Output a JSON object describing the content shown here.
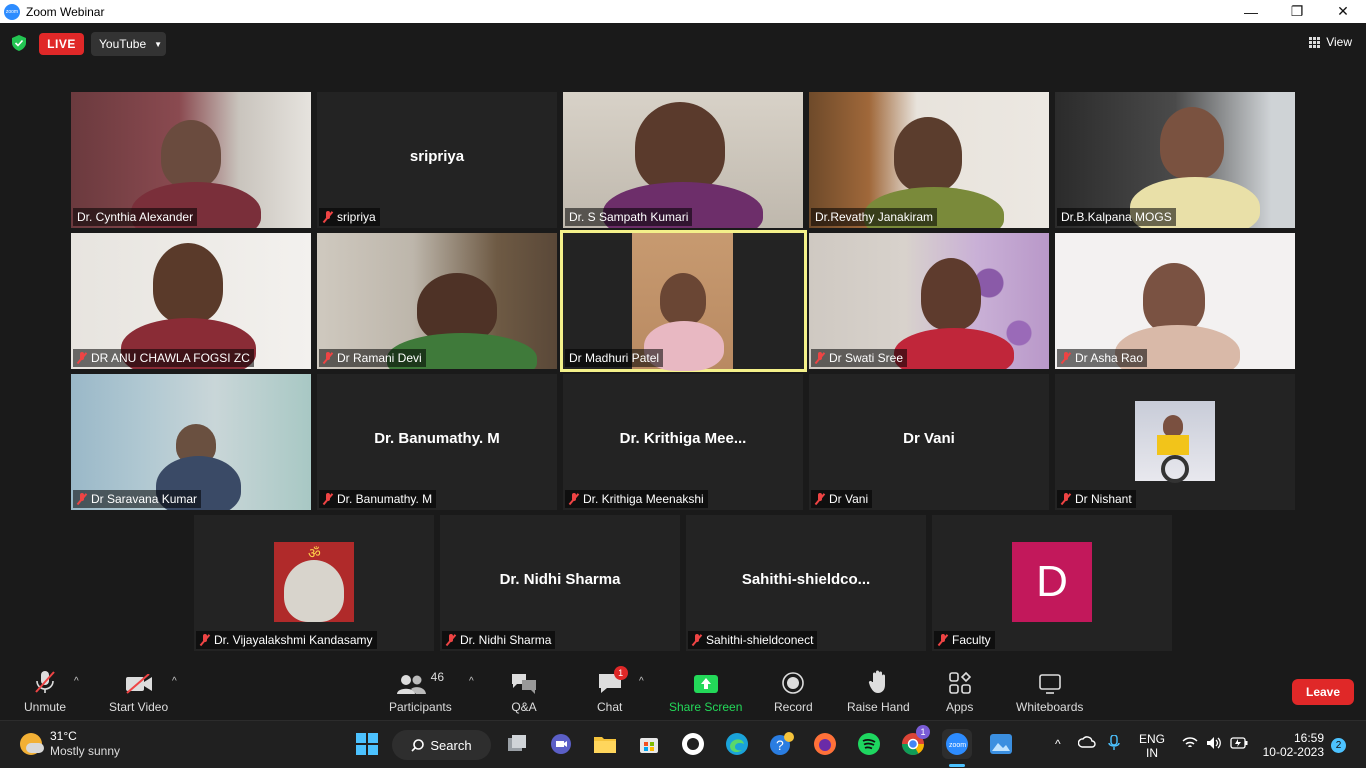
{
  "window": {
    "title": "Zoom Webinar",
    "minimize": "—",
    "restore": "❐",
    "close": "✕"
  },
  "topbar": {
    "live_label": "LIVE",
    "stream_label": "YouTube",
    "view_label": "View"
  },
  "colors": {
    "live_red": "#e02828",
    "active_border": "#f4f18a",
    "share_green": "#23d959",
    "avatar_bg": "#c2185b"
  },
  "tiles": [
    {
      "label": "Dr. Cynthia Alexander",
      "muted": false,
      "video": true
    },
    {
      "label": "sripriya",
      "center": "sripriya",
      "muted": true,
      "video": false
    },
    {
      "label": "Dr. S Sampath Kumari",
      "muted": false,
      "video": true
    },
    {
      "label": "Dr.Revathy Janakiram",
      "muted": false,
      "video": true
    },
    {
      "label": "Dr.B.Kalpana MOGS",
      "muted": false,
      "video": true
    },
    {
      "label": "DR ANU CHAWLA FOGSI ZC",
      "muted": true,
      "video": true
    },
    {
      "label": "Dr Ramani Devi",
      "muted": true,
      "video": true
    },
    {
      "label": "Dr Madhuri Patel",
      "muted": false,
      "video": true,
      "active": true
    },
    {
      "label": "Dr Swati Sree",
      "muted": true,
      "video": true
    },
    {
      "label": "Dr Asha Rao",
      "muted": true,
      "video": true
    },
    {
      "label": "Dr Saravana Kumar",
      "muted": true,
      "video": true
    },
    {
      "label": "Dr. Banumathy. M",
      "center": "Dr. Banumathy. M",
      "muted": true,
      "video": false
    },
    {
      "label": "Dr. Krithiga Meenakshi",
      "center": "Dr. Krithiga Mee...",
      "muted": true,
      "video": false
    },
    {
      "label": "Dr Vani",
      "center": "Dr Vani",
      "muted": true,
      "video": false
    },
    {
      "label": "Dr Nishant",
      "muted": true,
      "video": false,
      "avatar": "photo"
    },
    {
      "label": "Dr. Vijayalakshmi Kandasamy",
      "muted": true,
      "video": false,
      "avatar": "photo"
    },
    {
      "label": "Dr. Nidhi Sharma",
      "center": "Dr. Nidhi Sharma",
      "muted": true,
      "video": false
    },
    {
      "label": "Sahithi-shieldconect",
      "center": "Sahithi-shieldco...",
      "muted": true,
      "video": false
    },
    {
      "label": "Faculty",
      "muted": true,
      "video": false,
      "avatar": "letter",
      "letter": "D"
    }
  ],
  "toolbar": {
    "unmute": "Unmute",
    "start_video": "Start Video",
    "participants": "Participants",
    "participants_count": "46",
    "qa": "Q&A",
    "chat": "Chat",
    "chat_badge": "1",
    "share_screen": "Share Screen",
    "record": "Record",
    "raise_hand": "Raise Hand",
    "apps": "Apps",
    "whiteboards": "Whiteboards",
    "leave": "Leave"
  },
  "taskbar": {
    "temp": "31°C",
    "weather": "Mostly sunny",
    "search": "Search",
    "lang1": "ENG",
    "lang2": "IN",
    "time": "16:59",
    "date": "10-02-2023",
    "notif_count": "2",
    "teams_badge": "1"
  }
}
